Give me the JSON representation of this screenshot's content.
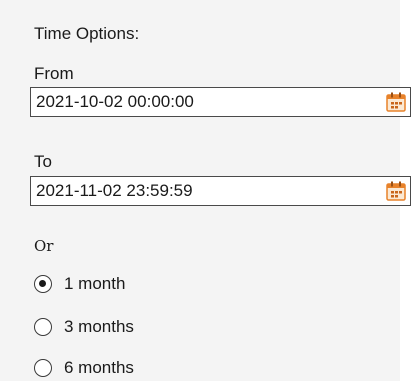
{
  "time_options": {
    "title": "Time Options:",
    "from": {
      "label": "From",
      "value": "2021-10-02 00:00:00",
      "picker_icon": "calendar-icon"
    },
    "to": {
      "label": "To",
      "value": "2021-11-02 23:59:59",
      "picker_icon": "calendar-icon"
    },
    "or_label": "Or",
    "periods": [
      {
        "label": "1 month",
        "selected": true
      },
      {
        "label": "3 months",
        "selected": false
      },
      {
        "label": "6 months",
        "selected": false
      }
    ]
  },
  "colors": {
    "panel_background": "#f4f4f4",
    "calendar_orange": "#e8822a"
  }
}
